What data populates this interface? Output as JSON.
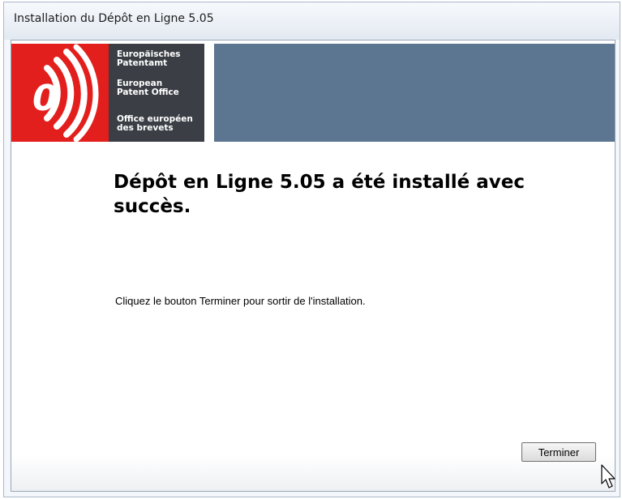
{
  "window": {
    "title": "Installation du Dépôt en Ligne 5.05"
  },
  "banner": {
    "logo_lines": [
      "Europäisches",
      "Patentamt",
      "European",
      "Patent Office",
      "Office européen",
      "des brevets"
    ],
    "colors": {
      "logo_red": "#e21f1d",
      "logo_dark": "#3b3f45",
      "banner_blue": "#5c7691"
    }
  },
  "content": {
    "heading": "Dépôt en Ligne 5.05 a été installé avec succès.",
    "instruction": "Cliquez le bouton Terminer pour sortir de l'installation."
  },
  "footer": {
    "finish_button": "Terminer"
  }
}
